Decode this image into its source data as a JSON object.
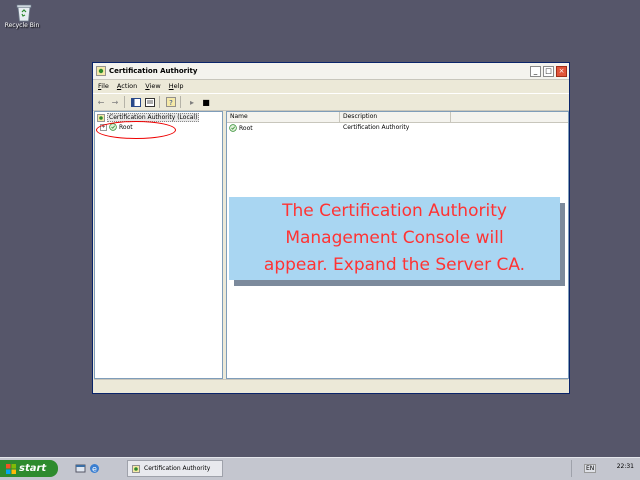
{
  "desktop": {
    "recycle_bin_label": "Recycle Bin"
  },
  "window": {
    "title": "Certification Authority",
    "menu": [
      {
        "u": "F",
        "rest": "ile"
      },
      {
        "u": "A",
        "rest": "ction"
      },
      {
        "u": "V",
        "rest": "iew"
      },
      {
        "u": "H",
        "rest": "elp"
      }
    ],
    "tree": {
      "root_label": "Certification Authority (Local)",
      "child_label": "Root"
    },
    "list": {
      "columns": [
        "Name",
        "Description"
      ],
      "rows": [
        {
          "name": "Root",
          "description": "Certification Authority"
        }
      ]
    }
  },
  "callout": {
    "text": "The Certification Authority\nManagement Console will\nappear. Expand the Server CA.",
    "color": "#ff3333",
    "background": "#a9d6f2"
  },
  "taskbar": {
    "start_label": "start",
    "task_label": "Certification Authority",
    "language": "EN",
    "clock": "22:31"
  }
}
